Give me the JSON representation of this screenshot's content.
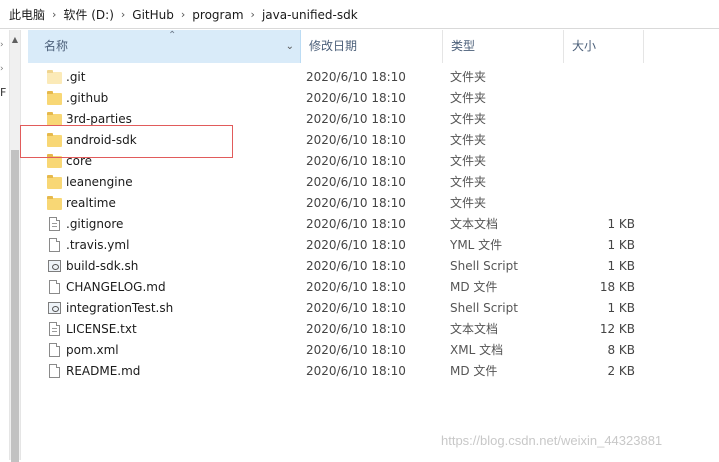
{
  "breadcrumb": [
    "此电脑",
    "软件 (D:)",
    "GitHub",
    "program",
    "java-unified-sdk"
  ],
  "columns": {
    "name": "名称",
    "date": "修改日期",
    "type": "类型",
    "size": "大小"
  },
  "left_pane_glyph": "F",
  "files": [
    {
      "name": ".git",
      "date": "2020/6/10 18:10",
      "type": "文件夹",
      "size": "",
      "icon": "folder-icon-light"
    },
    {
      "name": ".github",
      "date": "2020/6/10 18:10",
      "type": "文件夹",
      "size": "",
      "icon": "folder-icon"
    },
    {
      "name": "3rd-parties",
      "date": "2020/6/10 18:10",
      "type": "文件夹",
      "size": "",
      "icon": "folder-icon"
    },
    {
      "name": "android-sdk",
      "date": "2020/6/10 18:10",
      "type": "文件夹",
      "size": "",
      "icon": "folder-icon"
    },
    {
      "name": "core",
      "date": "2020/6/10 18:10",
      "type": "文件夹",
      "size": "",
      "icon": "folder-icon"
    },
    {
      "name": "leanengine",
      "date": "2020/6/10 18:10",
      "type": "文件夹",
      "size": "",
      "icon": "folder-icon"
    },
    {
      "name": "realtime",
      "date": "2020/6/10 18:10",
      "type": "文件夹",
      "size": "",
      "icon": "folder-icon"
    },
    {
      "name": ".gitignore",
      "date": "2020/6/10 18:10",
      "type": "文本文档",
      "size": "1 KB",
      "icon": "text-document-icon"
    },
    {
      "name": ".travis.yml",
      "date": "2020/6/10 18:10",
      "type": "YML 文件",
      "size": "1 KB",
      "icon": "document-icon"
    },
    {
      "name": "build-sdk.sh",
      "date": "2020/6/10 18:10",
      "type": "Shell Script",
      "size": "1 KB",
      "icon": "script-icon"
    },
    {
      "name": "CHANGELOG.md",
      "date": "2020/6/10 18:10",
      "type": "MD 文件",
      "size": "18 KB",
      "icon": "document-icon"
    },
    {
      "name": "integrationTest.sh",
      "date": "2020/6/10 18:10",
      "type": "Shell Script",
      "size": "1 KB",
      "icon": "script-icon"
    },
    {
      "name": "LICENSE.txt",
      "date": "2020/6/10 18:10",
      "type": "文本文档",
      "size": "12 KB",
      "icon": "text-document-icon"
    },
    {
      "name": "pom.xml",
      "date": "2020/6/10 18:10",
      "type": "XML 文档",
      "size": "8 KB",
      "icon": "document-icon"
    },
    {
      "name": "README.md",
      "date": "2020/6/10 18:10",
      "type": "MD 文件",
      "size": "2 KB",
      "icon": "document-icon"
    }
  ],
  "watermark": "https://blog.csdn.net/weixin_44323881"
}
